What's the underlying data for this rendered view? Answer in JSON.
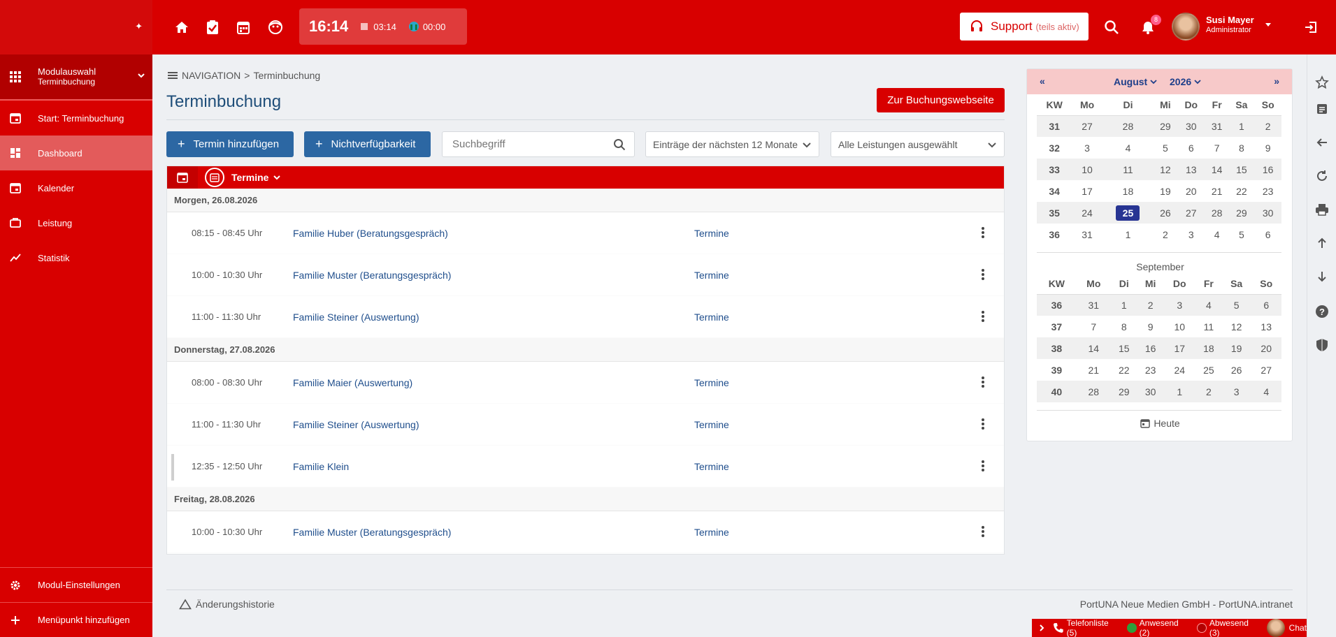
{
  "colors": {
    "brand_red": "#d80000",
    "link_blue": "#1f4e8c",
    "button_blue": "#2c67a3",
    "today": "#283593"
  },
  "sidebar": {
    "module": {
      "title": "Modulauswahl",
      "subtitle": "Terminbuchung"
    },
    "items": [
      {
        "label": "Start: Terminbuchung",
        "icon": "calendar-icon",
        "active": false
      },
      {
        "label": "Dashboard",
        "icon": "dashboard-icon",
        "active": true
      },
      {
        "label": "Kalender",
        "icon": "calendar-icon",
        "active": false
      },
      {
        "label": "Leistung",
        "icon": "briefcase-icon",
        "active": false
      },
      {
        "label": "Statistik",
        "icon": "trend-icon",
        "active": false
      }
    ],
    "bottom": [
      {
        "label": "Modul-Einstellungen",
        "icon": "gear-icon"
      },
      {
        "label": "Menüpunkt hinzufügen",
        "icon": "plus-icon"
      }
    ]
  },
  "topbar": {
    "clock": "16:14",
    "timer1": "03:14",
    "timer2": "00:00",
    "support_label": "Support",
    "support_sub": "(teils aktiv)",
    "notifications": "8",
    "user_name": "Susi Mayer",
    "user_role": "Administrator"
  },
  "breadcrumb": {
    "root": "NAVIGATION",
    "sep": ">",
    "current": "Terminbuchung"
  },
  "page_title": "Terminbuchung",
  "booking_button": "Zur Buchungswebseite",
  "toolbar": {
    "add_label": "Termin hinzufügen",
    "unavail_label": "Nichtverfügbarkeit",
    "search_placeholder": "Suchbegriff",
    "range_select": "Einträge der nächsten 12 Monate",
    "service_select": "Alle Leistungen ausgewählt"
  },
  "list": {
    "header_label": "Termine",
    "groups": [
      {
        "date": "Morgen, 26.08.2026",
        "rows": [
          {
            "time": "08:15 - 08:45 Uhr",
            "name": "Familie Huber (Beratungsgespräch)",
            "category": "Termine"
          },
          {
            "time": "10:00 - 10:30 Uhr",
            "name": "Familie Muster (Beratungsgespräch)",
            "category": "Termine"
          },
          {
            "time": "11:00 - 11:30 Uhr",
            "name": "Familie Steiner (Auswertung)",
            "category": "Termine"
          }
        ]
      },
      {
        "date": "Donnerstag, 27.08.2026",
        "rows": [
          {
            "time": "08:00 - 08:30 Uhr",
            "name": "Familie Maier (Auswertung)",
            "category": "Termine"
          },
          {
            "time": "11:00 - 11:30 Uhr",
            "name": "Familie Steiner (Auswertung)",
            "category": "Termine"
          },
          {
            "time": "12:35 - 12:50 Uhr",
            "name": "Familie Klein",
            "category": "Termine"
          }
        ]
      },
      {
        "date": "Freitag, 28.08.2026",
        "rows": [
          {
            "time": "10:00 - 10:30 Uhr",
            "name": "Familie Muster (Beratungsgespräch)",
            "category": "Termine"
          }
        ]
      }
    ]
  },
  "calendar": {
    "month": "August",
    "year": "2026",
    "weekday_headers": [
      "KW",
      "Mo",
      "Di",
      "Mi",
      "Do",
      "Fr",
      "Sa",
      "So"
    ],
    "august": [
      [
        "31",
        "27",
        "28",
        "29",
        "30",
        "31",
        "1",
        "2"
      ],
      [
        "32",
        "3",
        "4",
        "5",
        "6",
        "7",
        "8",
        "9"
      ],
      [
        "33",
        "10",
        "11",
        "12",
        "13",
        "14",
        "15",
        "16"
      ],
      [
        "34",
        "17",
        "18",
        "19",
        "20",
        "21",
        "22",
        "23"
      ],
      [
        "35",
        "24",
        "25",
        "26",
        "27",
        "28",
        "29",
        "30"
      ],
      [
        "36",
        "31",
        "1",
        "2",
        "3",
        "4",
        "5",
        "6"
      ]
    ],
    "today": "25",
    "next_month": "September",
    "september": [
      [
        "36",
        "31",
        "1",
        "2",
        "3",
        "4",
        "5",
        "6"
      ],
      [
        "37",
        "7",
        "8",
        "9",
        "10",
        "11",
        "12",
        "13"
      ],
      [
        "38",
        "14",
        "15",
        "16",
        "17",
        "18",
        "19",
        "20"
      ],
      [
        "39",
        "21",
        "22",
        "23",
        "24",
        "25",
        "26",
        "27"
      ],
      [
        "40",
        "28",
        "29",
        "30",
        "1",
        "2",
        "3",
        "4"
      ]
    ],
    "today_label": "Heute"
  },
  "footer": {
    "history": "Änderungshistorie",
    "copyright": "PortUNA Neue Medien GmbH - PortUNA.intranet"
  },
  "chatbar": {
    "phone": "Telefonliste (5)",
    "present": "Anwesend (2)",
    "absent": "Abwesend (3)",
    "chat": "Chat"
  }
}
